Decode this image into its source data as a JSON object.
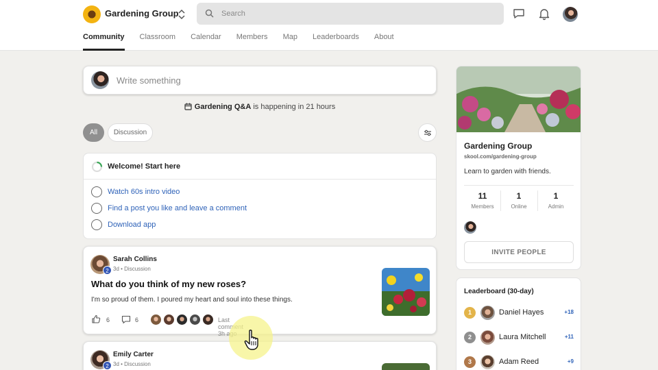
{
  "header": {
    "group_name": "Gardening Group",
    "search_placeholder": "Search",
    "icons": [
      "sunflower-logo",
      "chevron-updown-icon",
      "search-icon",
      "chat-icon",
      "bell-icon",
      "avatar"
    ]
  },
  "tabs": [
    {
      "label": "Community",
      "active": true
    },
    {
      "label": "Classroom"
    },
    {
      "label": "Calendar"
    },
    {
      "label": "Members"
    },
    {
      "label": "Map"
    },
    {
      "label": "Leaderboards"
    },
    {
      "label": "About"
    }
  ],
  "composer": {
    "placeholder": "Write something"
  },
  "event_banner": {
    "highlight": "Gardening Q&A",
    "rest": " is happening in 21 hours"
  },
  "filters": {
    "all": "All",
    "discussion": "Discussion"
  },
  "welcome": {
    "title": "Welcome! Start here",
    "tasks": [
      "Watch 60s intro video",
      "Find a post you like and leave a comment",
      "Download app"
    ]
  },
  "posts": [
    {
      "author": "Sarah Collins",
      "level": "2",
      "meta": "3d • Discussion",
      "title": "What do you think of my new roses?",
      "body": "I'm so proud of them. I poured my heart and soul into these things.",
      "likes": "6",
      "comments": "6",
      "last_comment": "Last comment 3h ago"
    },
    {
      "author": "Emily Carter",
      "level": "2",
      "meta": "3d • Discussion"
    }
  ],
  "about": {
    "name": "Gardening Group",
    "url": "skool.com/gardening-group",
    "description": "Learn to garden with friends.",
    "stats": [
      {
        "value": "11",
        "label": "Members"
      },
      {
        "value": "1",
        "label": "Online"
      },
      {
        "value": "1",
        "label": "Admin"
      }
    ],
    "invite_label": "INVITE PEOPLE"
  },
  "leaderboard": {
    "title": "Leaderboard (30-day)",
    "rows": [
      {
        "rank": "1",
        "name": "Daniel Hayes",
        "points": "+18",
        "medal_color": "#e3b44a"
      },
      {
        "rank": "2",
        "name": "Laura Mitchell",
        "points": "+11",
        "medal_color": "#8f8f8f"
      },
      {
        "rank": "3",
        "name": "Adam Reed",
        "points": "+9",
        "medal_color": "#b0784a"
      }
    ]
  },
  "colors": {
    "link": "#2e62b8",
    "level_badge": "#3457b5",
    "highlight": "#f5f38c"
  }
}
